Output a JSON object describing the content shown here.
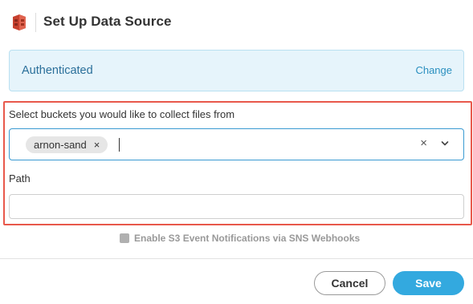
{
  "header": {
    "title": "Set Up Data Source",
    "logo_icon": "aws-s3-bucket-icon",
    "logo_color": "#c7412f"
  },
  "auth": {
    "status": "Authenticated",
    "change_label": "Change"
  },
  "buckets": {
    "label": "Select buckets you would like to collect files from",
    "selected": [
      "arnon-sand"
    ],
    "tag_remove_glyph": "×",
    "clear_glyph": "×"
  },
  "path": {
    "label": "Path",
    "value": "",
    "placeholder": ""
  },
  "sns": {
    "label": "Enable S3 Event Notifications via SNS Webhooks",
    "checked": false
  },
  "footer": {
    "cancel_label": "Cancel",
    "save_label": "Save"
  },
  "colors": {
    "accent": "#33a9df",
    "highlight": "#e8584b",
    "auth_bg": "#e6f4fb"
  }
}
